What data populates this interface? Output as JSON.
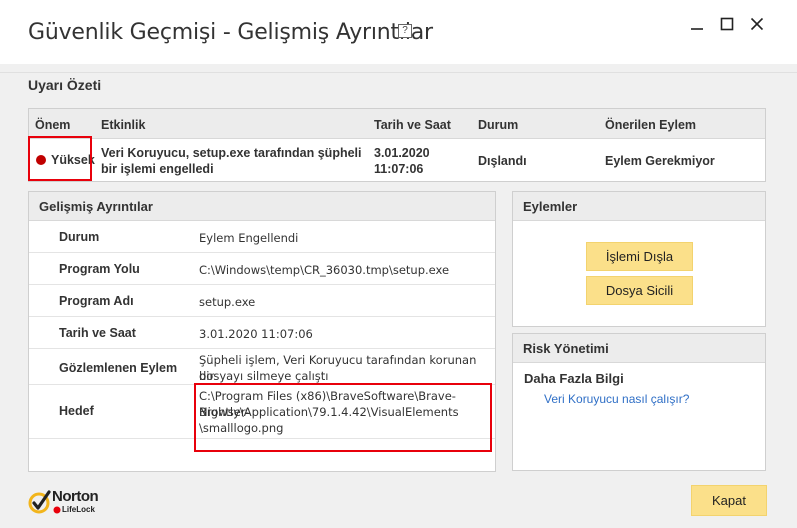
{
  "window": {
    "title": "Güvenlik Geçmişi - Gelişmiş Ayrıntılar",
    "help_glyph": "?"
  },
  "summary": {
    "section_title": "Uyarı Özeti",
    "columns": [
      "Önem",
      "Etkinlik",
      "Tarih ve Saat",
      "Durum",
      "Önerilen Eylem"
    ],
    "row": {
      "severity": "Yüksek",
      "activity_line1": "Veri Koruyucu, setup.exe tarafından şüpheli",
      "activity_line2": "bir işlemi engelledi",
      "date_line1": "3.01.2020",
      "date_line2": "11:07:06",
      "status": "Dışlandı",
      "recommended": "Eylem Gerekmiyor"
    }
  },
  "details": {
    "title": "Gelişmiş Ayrıntılar",
    "rows": [
      {
        "key": "Durum",
        "value": "Eylem Engellendi"
      },
      {
        "key": "Program Yolu",
        "value": "C:\\Windows\\temp\\CR_36030.tmp\\setup.exe"
      },
      {
        "key": "Program Adı",
        "value": "setup.exe"
      },
      {
        "key": "Tarih ve Saat",
        "value": "3.01.2020 11:07:06"
      },
      {
        "key": "Gözlemlenen Eylem",
        "value_line1": "Şüpheli işlem, Veri Koruyucu tarafından korunan bir",
        "value_line2": "dosyayı silmeye çalıştı"
      },
      {
        "key": "Hedef",
        "value_line1": "C:\\Program Files (x86)\\BraveSoftware\\Brave-Browser-",
        "value_line2": "Nightly\\Application\\79.1.4.42\\VisualElements",
        "value_line3": "\\smalllogo.png"
      }
    ]
  },
  "actions": {
    "title": "Eylemler",
    "exclude_label": "İşlemi Dışla",
    "file_record_label": "Dosya Sicili"
  },
  "risk": {
    "title": "Risk Yönetimi",
    "more_info": "Daha Fazla Bilgi",
    "link": "Veri Koruyucu nasıl çalışır?"
  },
  "footer": {
    "brand": "Norton",
    "sub_brand": "LifeLock",
    "close_label": "Kapat"
  },
  "colors": {
    "accent_button": "#fbe08a",
    "highlight_box": "#e8000b",
    "severity_high": "#c00000",
    "link": "#2f6fc6"
  }
}
